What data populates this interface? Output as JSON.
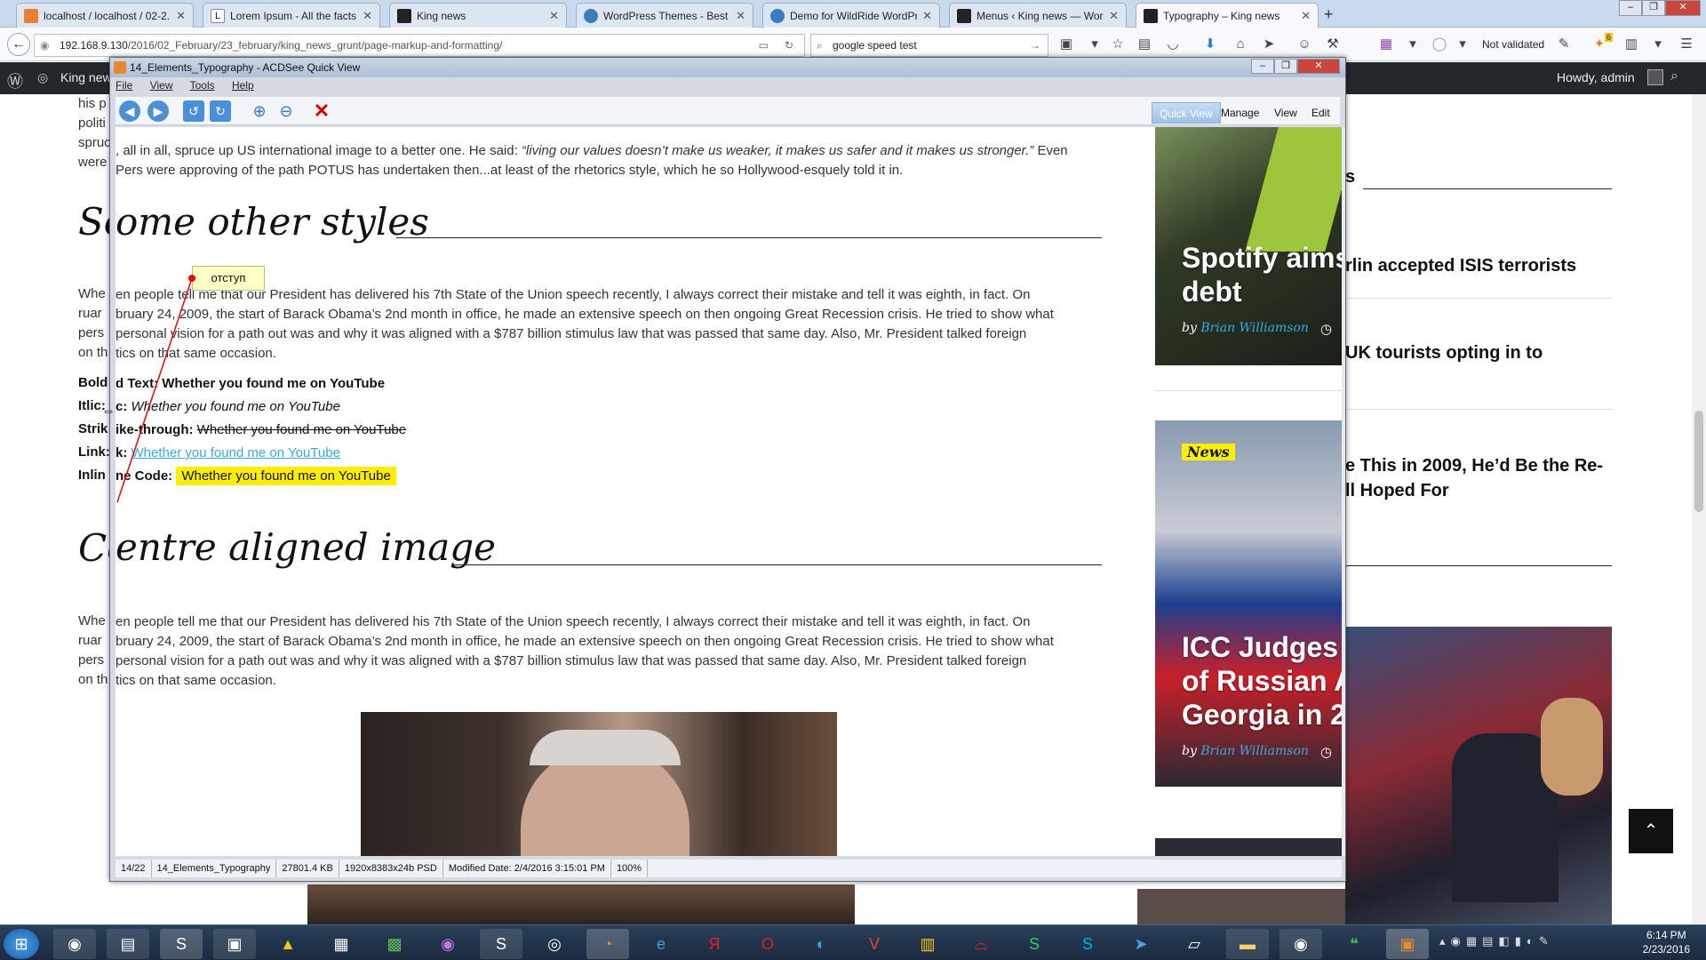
{
  "browser": {
    "tabs": [
      {
        "label": "localhost / localhost / 02-2...",
        "active": false
      },
      {
        "label": "Lorem Ipsum - All the facts...",
        "active": false
      },
      {
        "label": "King news",
        "active": false
      },
      {
        "label": "WordPress Themes - Best ...",
        "active": false
      },
      {
        "label": "Demo for WildRide WordPr...",
        "active": false
      },
      {
        "label": "Menus ‹ King news — Wor...",
        "active": false
      },
      {
        "label": "Typography – King news",
        "active": true
      }
    ],
    "new_tab": "+",
    "url_host": "192.168.9.130",
    "url_path": "/2016/02_February/23_february/king_news_grunt/page-markup-and-formatting/",
    "search_value": "google speed test",
    "not_validated": "Not validated",
    "badge_count": "6"
  },
  "wp_admin": {
    "site_name": "King news",
    "howdy": "Howdy, admin"
  },
  "page": {
    "intro_frag1": "his p",
    "intro_frag2": "politi",
    "intro_line3_a": "spruc",
    "intro_line3_b": ", all in all, spruce up US international image to a better one. He said: ",
    "intro_quote": "“living our values doesn’t make us weaker, it makes us safer and it makes us stronger.”",
    "intro_line3_c": " Even",
    "intro_line4_a": "were",
    "intro_line4_b": "Pers were approving of the path POTUS has undertaken then...at least of the rhetorics style, which he so Hollywood-esquely told it in.",
    "heading1_a": "So",
    "heading1_b": "ome other styles",
    "para1": [
      {
        "left": "Whe",
        "right": "en people tell me that our President has delivered his 7th State of the Union speech recently, I always correct their mistake and tell it was eighth, in fact. On"
      },
      {
        "left": "ruar",
        "right": "bruary 24, 2009, the start of Barack Obama’s 2nd month in office, he made an extensive speech on then ongoing Great Recession crisis. He tried to show what"
      },
      {
        "left": "pers",
        "right": "personal vision for a path out was and why it was aligned with a $787 billion stimulus law that was passed that same day. Also, Mr. President talked foreign"
      },
      {
        "left": "on th",
        "right": "tics on that same occasion."
      }
    ],
    "bold_left": "Bold",
    "bold_right": "d Text: Whether you found me on YouTube",
    "italic_left": "Itlic:",
    "italic_label": "c: ",
    "italic_text": "Whether you found me on YouTube",
    "strike_left": "Strik",
    "strike_label": "ike-through: ",
    "strike_text": "Whether you found me on YouTube",
    "link_left": "Link:",
    "link_label": "k: ",
    "link_text": "Whether you found me on YouTube",
    "code_left": "Inlin",
    "code_label": "ne Code: ",
    "code_text": "Whether you found me on YouTube",
    "heading2_a": "Ce",
    "heading2_b": "entre aligned image",
    "para2": [
      {
        "left": "Whe",
        "right": "en people tell me that our President has delivered his 7th State of the Union speech recently, I always correct their mistake and tell it was eighth, in fact. On"
      },
      {
        "left": "ruar",
        "right": "bruary 24, 2009, the start of Barack Obama’s 2nd month in office, he made an extensive speech on then ongoing Great Recession crisis. He tried to show what"
      },
      {
        "left": "pers",
        "right": "personal vision for a path out was and why it was aligned with a $787 billion stimulus law that was passed that same day. Also, Mr. President talked foreign"
      },
      {
        "left": "on th",
        "right": "tics on that same occasion."
      }
    ],
    "annotation": "отступ"
  },
  "sidebar": {
    "head_frag": "s",
    "item1": "rlin accepted ISIS terrorists",
    "item2": "UK tourists opting in to",
    "item3_a": "e This in 2009, He’d Be the Re-",
    "item3_b": "ll Hoped For",
    "card1_title_a": "Spotify aims",
    "card1_title_b": "debt",
    "card1_by": "by ",
    "card1_author": "Brian Williamson",
    "card2_badge": "News",
    "card2_title_a": "ICC Judges S",
    "card2_title_b": "of Russian A",
    "card2_title_c": "Georgia in 2",
    "card2_by": "by ",
    "card2_author": "Brian Williamson"
  },
  "acdsee": {
    "title": "14_Elements_Typography - ACDSee Quick View",
    "menu": [
      "File",
      "View",
      "Tools",
      "Help"
    ],
    "modes": [
      "Quick View",
      "Manage",
      "View",
      "Edit"
    ],
    "status": [
      "14/22",
      "14_Elements_Typography",
      "27801.4 KB",
      "1920x8383x24b PSD",
      "Modified Date: 2/4/2016 3:15:01 PM",
      "100%"
    ]
  },
  "taskbar": {
    "time": "6:14 PM",
    "date": "2/23/2016"
  },
  "colors": {
    "accent_blue": "#3aa8e0",
    "highlight_yellow": "#ffee00",
    "wp_bar": "#23282d",
    "close_red": "#d40000"
  }
}
